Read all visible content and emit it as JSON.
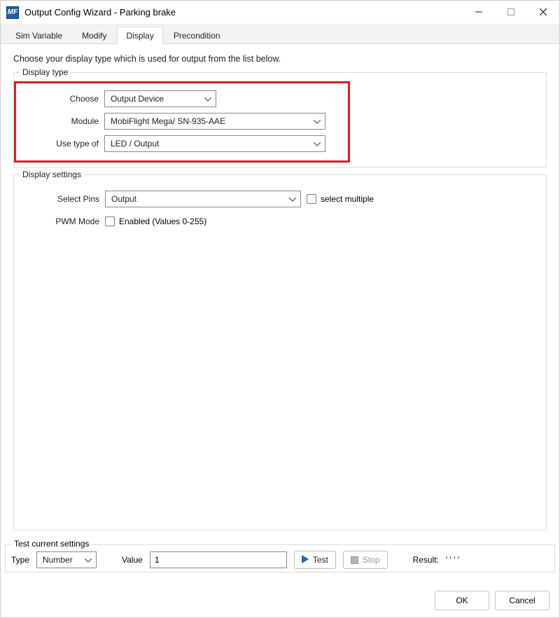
{
  "window": {
    "title": "Output Config Wizard - Parking brake",
    "icon_label": "MF"
  },
  "tabs": [
    {
      "label": "Sim Variable",
      "active": false
    },
    {
      "label": "Modify",
      "active": false
    },
    {
      "label": "Display",
      "active": true
    },
    {
      "label": "Precondition",
      "active": false
    }
  ],
  "intro_text": "Choose your display type which is used for output from the list below.",
  "display_type": {
    "legend": "Display type",
    "rows": {
      "choose": {
        "label": "Choose",
        "value": "Output Device"
      },
      "module": {
        "label": "Module",
        "value": "MobiFlight Mega/ SN-935-AAE"
      },
      "use_type": {
        "label": "Use type of",
        "value": "LED / Output"
      }
    }
  },
  "display_settings": {
    "legend": "Display settings",
    "select_pins": {
      "label": "Select Pins",
      "value": "Output"
    },
    "select_multiple": {
      "label": "select multiple",
      "checked": false
    },
    "pwm_mode": {
      "label": "PWM Mode",
      "check_label": "Enabled (Values 0-255)",
      "checked": false
    }
  },
  "test": {
    "legend": "Test current settings",
    "type_label": "Type",
    "type_value": "Number",
    "value_label": "Value",
    "value_value": "1",
    "test_btn": "Test",
    "stop_btn": "Stop",
    "result_label": "Result:",
    "result_value": "' ' ' '"
  },
  "buttons": {
    "ok": "OK",
    "cancel": "Cancel"
  }
}
